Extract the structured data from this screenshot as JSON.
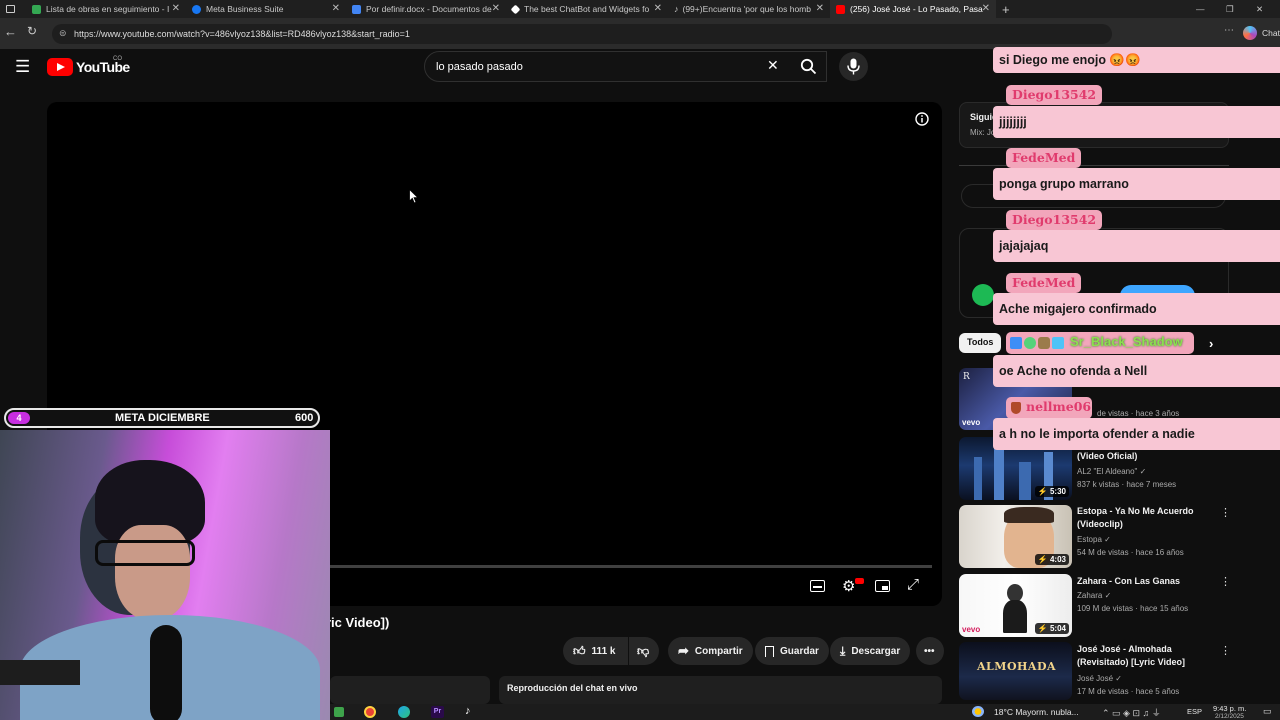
{
  "browser": {
    "tabs": [
      {
        "label": "Lista de obras en seguimiento - I",
        "color": "#34a853"
      },
      {
        "label": "Meta Business Suite",
        "color": "#1877f2"
      },
      {
        "label": "Por definir.docx - Documentos de",
        "color": "#4285f4"
      },
      {
        "label": "The best ChatBot and Widgets fo",
        "color": "#ffffff"
      },
      {
        "label": "(99+)Encuentra 'por que los homb",
        "color": "#ffffff"
      },
      {
        "label": "(256) José José - Lo Pasado, Pasa",
        "color": "#ff0000"
      }
    ],
    "url": "https://www.youtube.com/watch?v=486vlyoz138&list=RD486vlyoz138&start_radio=1",
    "copilot_label": "Chat"
  },
  "youtube": {
    "logo_text": "YouTube",
    "logo_region": "CO",
    "search_value": "lo pasado pasado",
    "video_title_fragment": "ric Video])",
    "actions": {
      "likes": "111 k",
      "share": "Compartir",
      "save": "Guardar",
      "download": "Descargar"
    },
    "chat_replay": "Reproducción del chat en vivo",
    "sidebar_partial": {
      "next_label": "Siguie",
      "mix_label": "Mix: Jo",
      "chip_all": "Todos"
    },
    "related": [
      {
        "title": "(Video Oficial)",
        "channel": "AL2 \"El Aldeano\"",
        "stats": "837 k vistas · hace 7 meses",
        "duration": "5:30",
        "thumb": "city"
      },
      {
        "title": "Estopa - Ya No Me Acuerdo (Videoclip)",
        "channel": "Estopa",
        "stats": "54 M de vistas · hace 16 años",
        "duration": "4:03",
        "thumb": "face"
      },
      {
        "title": "Zahara - Con Las Ganas",
        "channel": "Zahara",
        "stats": "109 M de vistas · hace 15 años",
        "duration": "5:04",
        "thumb": "bw"
      },
      {
        "title": "José José - Almohada (Revisitado) [Lyric Video]",
        "channel": "José José",
        "stats": "17 M de vistas · hace 5 años",
        "duration": "",
        "thumb": "almohada"
      }
    ],
    "almohada_thumb_text": "ALMOHADA",
    "vevo_label": "vevo",
    "hidden_meta": "de vistas · hace 3 años"
  },
  "chat": {
    "messages": [
      {
        "user": "",
        "text": "si Diego me enojo 😡😡"
      },
      {
        "user": "Diego13542",
        "text": "jjjjjjjj"
      },
      {
        "user": "FedeMed",
        "text": "ponga grupo marrano"
      },
      {
        "user": "Diego13542",
        "text": "jajajajaq"
      },
      {
        "user": "FedeMed",
        "text": "Ache migajero confirmado"
      },
      {
        "user": "Sr_Black_Shadow",
        "text": "oe Ache no ofenda a Nell"
      },
      {
        "user": "nellme06",
        "text": "a h no le importa ofender a nadie"
      }
    ]
  },
  "stream": {
    "goal_count": "4",
    "goal_label": "META DICIEMBRE",
    "goal_target": "600"
  },
  "taskbar": {
    "weather": "18°C  Mayorm. nubla...",
    "lang": "ESP",
    "time": "9:43 p. m.",
    "date": "2/12/2025"
  }
}
